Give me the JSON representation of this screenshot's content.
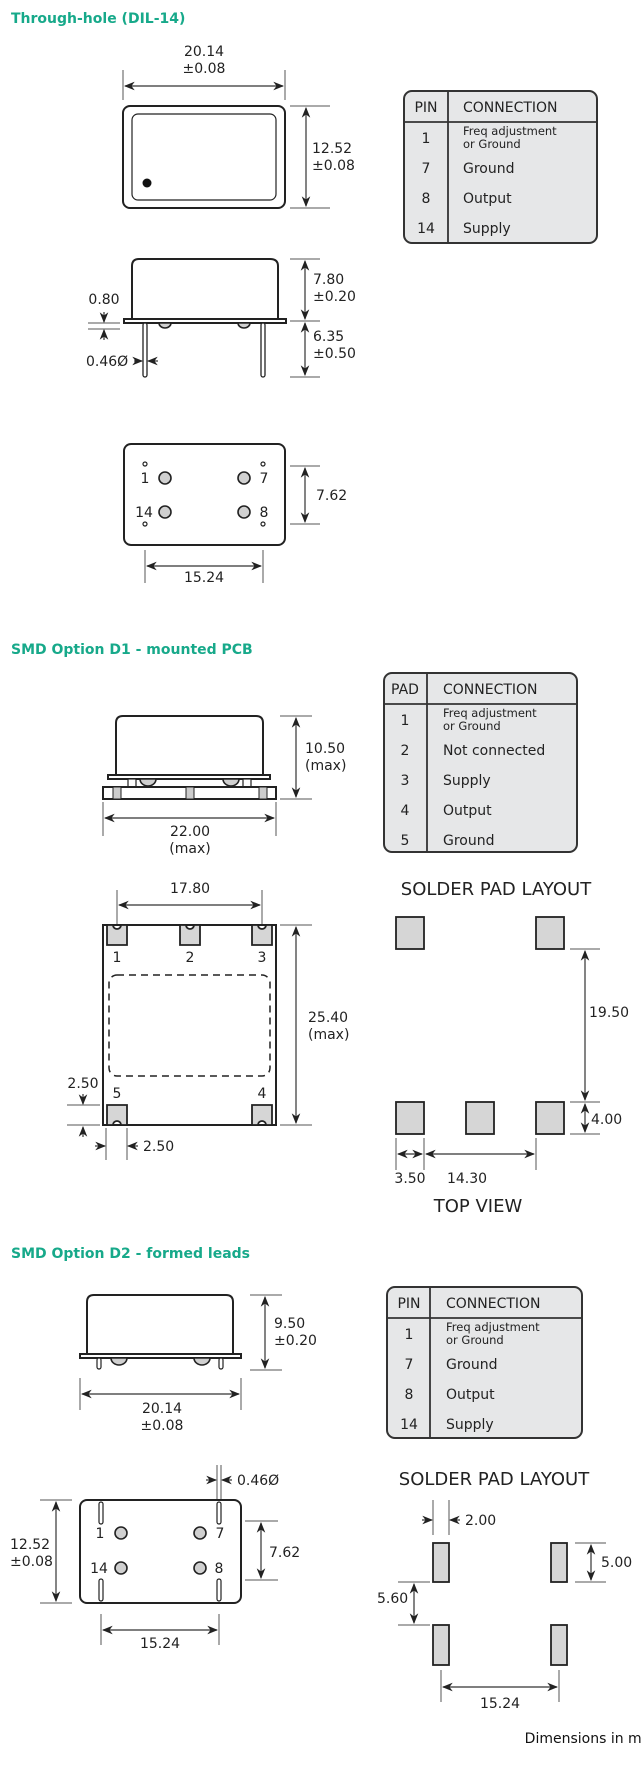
{
  "footer": "Dimensions in mm",
  "colors": {
    "heading": "#17a98a",
    "table_fill": "#e6e7e8",
    "pad_fill": "#d6d6d6"
  },
  "sections": {
    "dil14": {
      "title": "Through-hole (DIL-14)",
      "dims": {
        "width": "20.14",
        "width_tol": "±0.08",
        "height": "12.52",
        "height_tol": "±0.08",
        "body_height": "7.80",
        "body_height_tol": "±0.20",
        "lead_length": "6.35",
        "lead_length_tol": "±0.50",
        "flange": "0.80",
        "lead_dia": "0.46Ø",
        "pin_row_spacing": "7.62",
        "pin_col_spacing": "15.24"
      },
      "pin_labels": [
        "1",
        "7",
        "14",
        "8"
      ],
      "table": {
        "col1": "PIN",
        "col2": "CONNECTION",
        "rows": [
          {
            "pin": "1",
            "line1": "Freq adjustment",
            "line2": "or Ground"
          },
          {
            "pin": "7",
            "conn": "Ground"
          },
          {
            "pin": "8",
            "conn": "Output"
          },
          {
            "pin": "14",
            "conn": "Supply"
          }
        ]
      }
    },
    "d1": {
      "title": "SMD Option D1 - mounted PCB",
      "dims": {
        "height": "10.50",
        "height_note": "(max)",
        "width": "22.00",
        "width_note": "(max)",
        "pad_span": "17.80",
        "length": "25.40",
        "length_note": "(max)",
        "pad_h": "2.50",
        "pad_w": "2.50"
      },
      "pad_labels": [
        "1",
        "2",
        "3",
        "5",
        "4"
      ],
      "table": {
        "col1": "PAD",
        "col2": "CONNECTION",
        "rows": [
          {
            "pin": "1",
            "line1": "Freq adjustment",
            "line2": "or Ground"
          },
          {
            "pin": "2",
            "conn": "Not connected"
          },
          {
            "pin": "3",
            "conn": "Supply"
          },
          {
            "pin": "4",
            "conn": "Output"
          },
          {
            "pin": "5",
            "conn": "Ground"
          }
        ]
      },
      "solder": {
        "title": "SOLDER PAD LAYOUT",
        "view": "TOP VIEW",
        "vspan": "19.50",
        "pad_size": "4.00",
        "pad_w": "3.50",
        "pad_pitch": "14.30"
      }
    },
    "d2": {
      "title": "SMD Option D2 - formed leads",
      "dims": {
        "height": "9.50",
        "height_tol": "±0.20",
        "width": "20.14",
        "width_tol": "±0.08",
        "lead_dia": "0.46Ø",
        "length": "12.52",
        "length_tol": "±0.08",
        "pin_row_spacing": "7.62",
        "pin_col_spacing": "15.24"
      },
      "pin_labels": [
        "1",
        "7",
        "14",
        "8"
      ],
      "table": {
        "col1": "PIN",
        "col2": "CONNECTION",
        "rows": [
          {
            "pin": "1",
            "line1": "Freq adjustment",
            "line2": "or Ground"
          },
          {
            "pin": "7",
            "conn": "Ground"
          },
          {
            "pin": "8",
            "conn": "Output"
          },
          {
            "pin": "14",
            "conn": "Supply"
          }
        ]
      },
      "solder": {
        "title": "SOLDER PAD LAYOUT",
        "pad_w": "2.00",
        "pad_h": "5.00",
        "gap": "5.60",
        "pitch": "15.24"
      }
    }
  }
}
